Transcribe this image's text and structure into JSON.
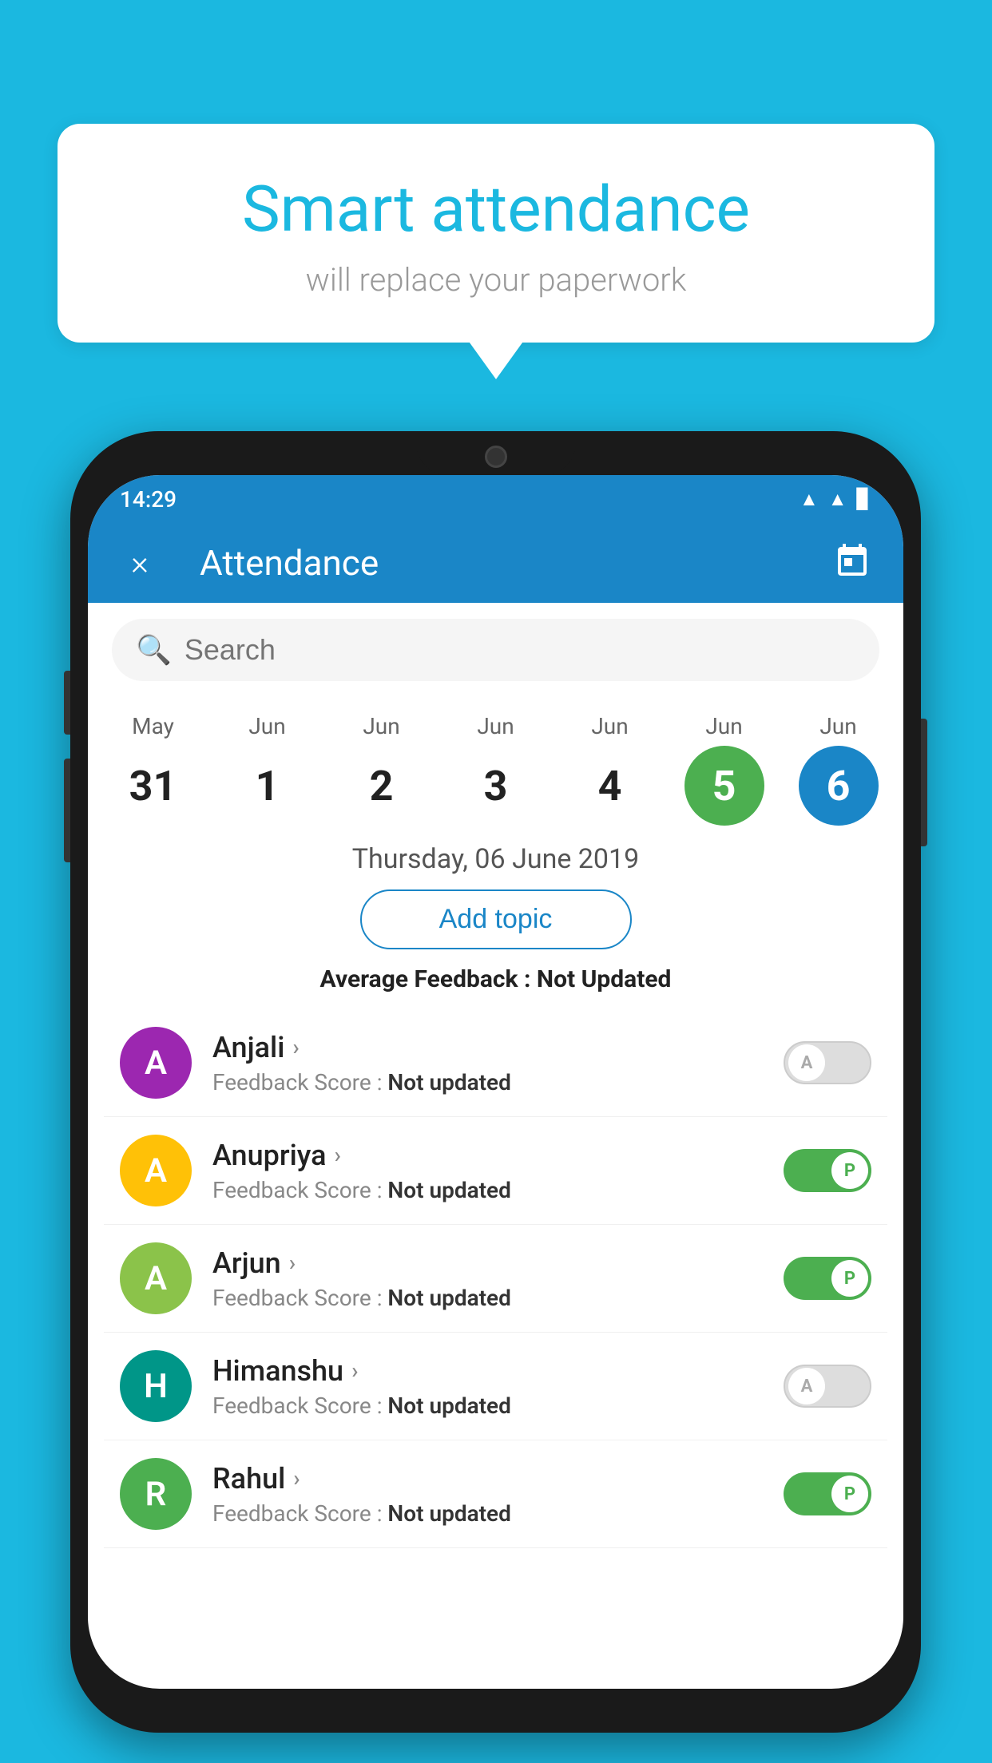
{
  "background": {
    "color": "#1BB8E0"
  },
  "speech_bubble": {
    "title": "Smart attendance",
    "subtitle": "will replace your paperwork"
  },
  "status_bar": {
    "time": "14:29",
    "wifi_icon": "▲",
    "signal_icon": "▲",
    "battery_icon": "▊"
  },
  "header": {
    "title": "Attendance",
    "close_label": "×",
    "calendar_label": "📅"
  },
  "search": {
    "placeholder": "Search"
  },
  "calendar": {
    "days": [
      {
        "month": "May",
        "date": "31",
        "state": "normal"
      },
      {
        "month": "Jun",
        "date": "1",
        "state": "normal"
      },
      {
        "month": "Jun",
        "date": "2",
        "state": "normal"
      },
      {
        "month": "Jun",
        "date": "3",
        "state": "normal"
      },
      {
        "month": "Jun",
        "date": "4",
        "state": "normal"
      },
      {
        "month": "Jun",
        "date": "5",
        "state": "today"
      },
      {
        "month": "Jun",
        "date": "6",
        "state": "selected"
      }
    ]
  },
  "selected_date": "Thursday, 06 June 2019",
  "add_topic_label": "Add topic",
  "average_feedback": {
    "label": "Average Feedback : ",
    "value": "Not Updated"
  },
  "students": [
    {
      "name": "Anjali",
      "initial": "A",
      "avatar_color": "avatar-purple",
      "feedback_label": "Feedback Score : ",
      "feedback_value": "Not updated",
      "toggle_state": "off",
      "toggle_label": "A"
    },
    {
      "name": "Anupriya",
      "initial": "A",
      "avatar_color": "avatar-amber",
      "feedback_label": "Feedback Score : ",
      "feedback_value": "Not updated",
      "toggle_state": "on",
      "toggle_label": "P"
    },
    {
      "name": "Arjun",
      "initial": "A",
      "avatar_color": "avatar-light-green",
      "feedback_label": "Feedback Score : ",
      "feedback_value": "Not updated",
      "toggle_state": "on",
      "toggle_label": "P"
    },
    {
      "name": "Himanshu",
      "initial": "H",
      "avatar_color": "avatar-teal",
      "feedback_label": "Feedback Score : ",
      "feedback_value": "Not updated",
      "toggle_state": "off",
      "toggle_label": "A"
    },
    {
      "name": "Rahul",
      "initial": "R",
      "avatar_color": "avatar-green",
      "feedback_label": "Feedback Score : ",
      "feedback_value": "Not updated",
      "toggle_state": "on",
      "toggle_label": "P"
    }
  ]
}
